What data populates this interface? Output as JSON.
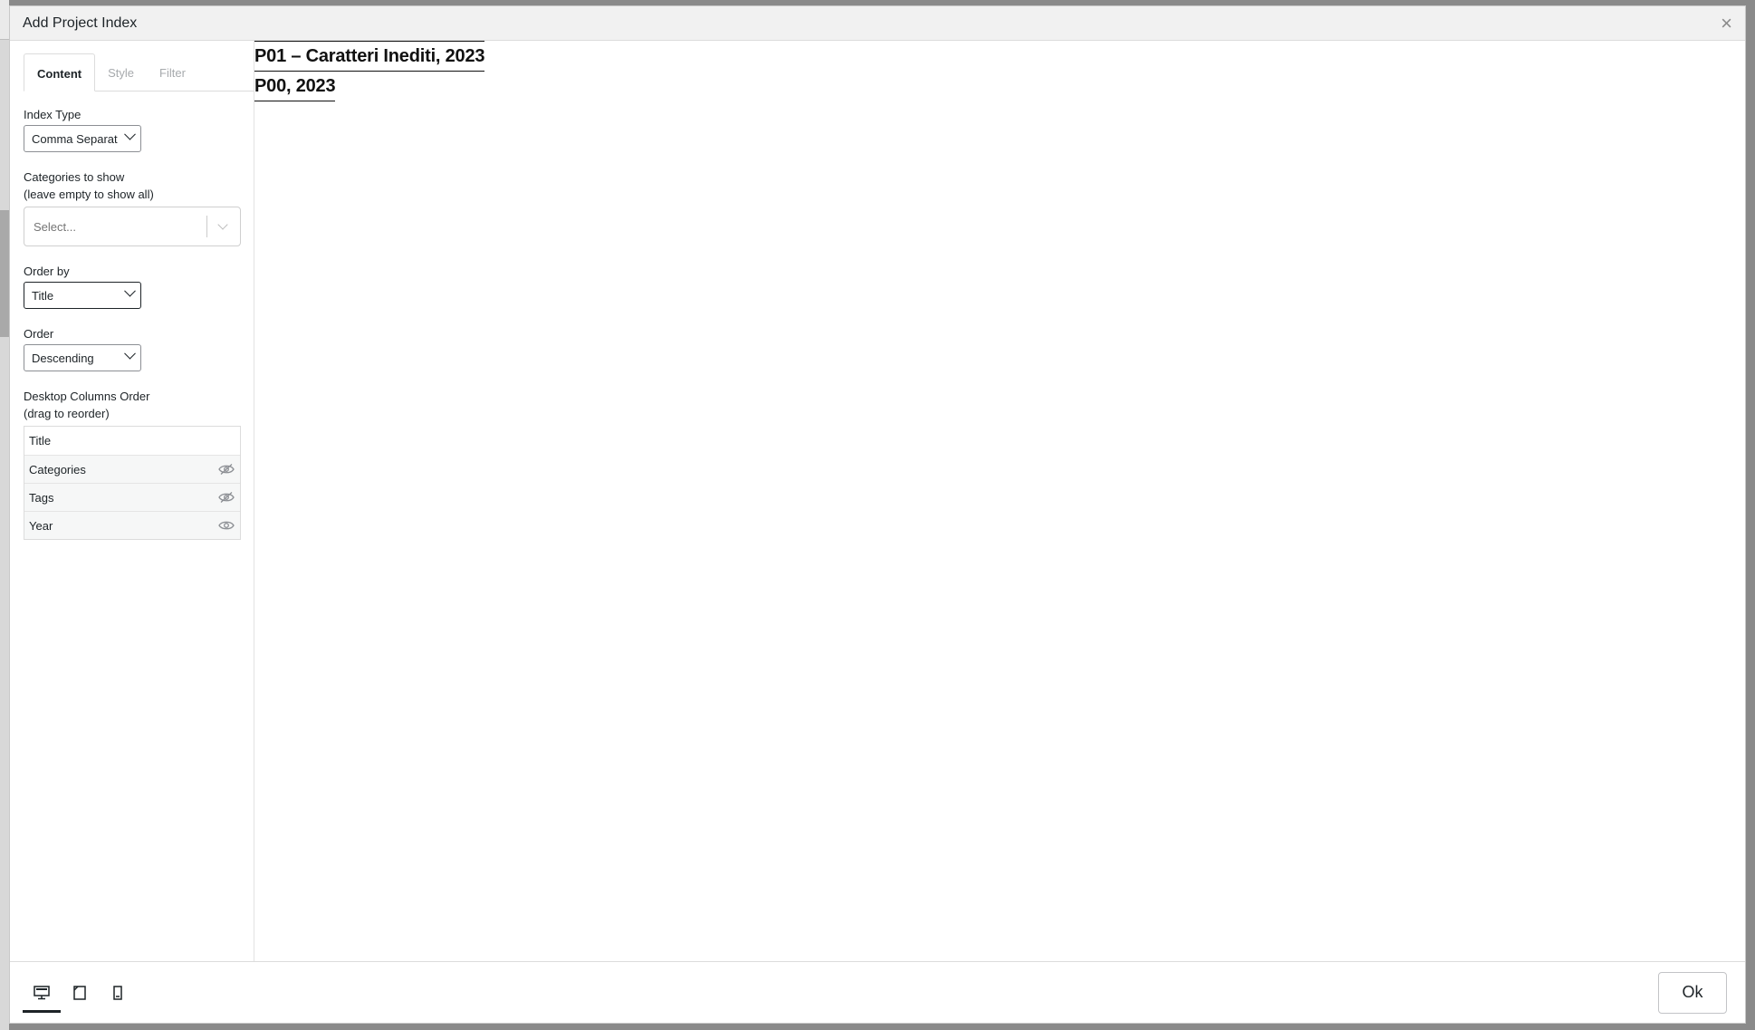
{
  "modal": {
    "title": "Add Project Index",
    "close_glyph": "×"
  },
  "tabs": [
    {
      "label": "Content"
    },
    {
      "label": "Style"
    },
    {
      "label": "Filter"
    }
  ],
  "fields": {
    "index_type": {
      "label": "Index Type",
      "value": "Comma Separat"
    },
    "categories": {
      "label_line1": "Categories to show",
      "label_line2": "(leave empty to show all)",
      "placeholder": "Select..."
    },
    "order_by": {
      "label": "Order by",
      "value": "Title"
    },
    "order": {
      "label": "Order",
      "value": "Descending"
    },
    "columns": {
      "label_line1": "Desktop Columns Order",
      "label_line2": "(drag to reorder)",
      "items": [
        {
          "label": "Title",
          "icon": ""
        },
        {
          "label": "Categories",
          "icon": "eye-slash-icon"
        },
        {
          "label": "Tags",
          "icon": "eye-slash-icon"
        },
        {
          "label": "Year",
          "icon": "eye-icon"
        }
      ]
    }
  },
  "preview": {
    "entries": [
      "P01 – Caratteri Inediti, 2023",
      "P00, 2023"
    ]
  },
  "footer": {
    "devices": [
      {
        "icon": "desktop-icon"
      },
      {
        "icon": "tablet-icon"
      },
      {
        "icon": "mobile-icon"
      }
    ],
    "ok_label": "Ok"
  }
}
